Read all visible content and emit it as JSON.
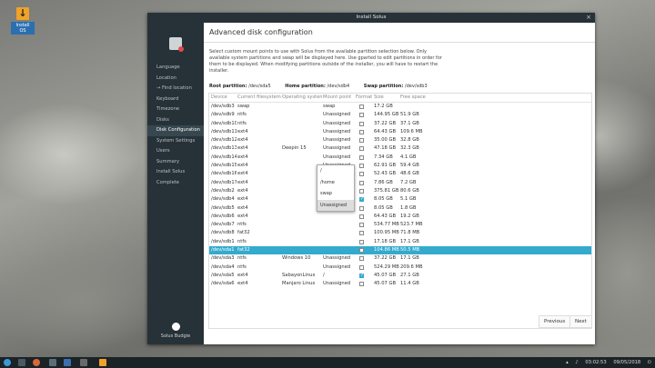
{
  "desktop": {
    "icon_label": "Install OS"
  },
  "window": {
    "title": "Install Solus",
    "close_glyph": "×"
  },
  "sidebar": {
    "items": [
      {
        "label": "Language"
      },
      {
        "label": "Location"
      },
      {
        "label": "→ Find location"
      },
      {
        "label": "Keyboard"
      },
      {
        "label": "Timezone"
      },
      {
        "label": "Disks"
      },
      {
        "label": "Disk Configuration"
      },
      {
        "label": "System Settings"
      },
      {
        "label": "Users"
      },
      {
        "label": "Summary"
      },
      {
        "label": "Install Solus"
      },
      {
        "label": "Complete"
      }
    ],
    "brand": "Solus Budgie"
  },
  "page": {
    "title": "Advanced disk configuration",
    "description": "Select custom mount points to use with Solus from the available partition selection below. Only available system partitions and swap will be displayed here. Use gparted to edit partitions in order for them to be displayed. When modifying partitions outside of the installer, you will have to restart the installer.",
    "root_label": "Root partition:",
    "root_value": "/dev/sda5",
    "home_label": "Home partition:",
    "home_value": "/dev/sdb4",
    "swap_label": "Swap partition:",
    "swap_value": "/dev/sdb3"
  },
  "table": {
    "headers": [
      "Device",
      "Current filesystem",
      "Operating system",
      "Mount point",
      "Format",
      "Size",
      "Free space"
    ],
    "rows": [
      {
        "device": "/dev/sdb3",
        "fs": "swap",
        "os": "",
        "mount": "swap",
        "format": false,
        "size": "17.2 GB",
        "free": ""
      },
      {
        "device": "/dev/sdb9",
        "fs": "ntfs",
        "os": "",
        "mount": "Unassigned",
        "format": false,
        "size": "144.95 GB",
        "free": "51.9 GB"
      },
      {
        "device": "/dev/sdb10",
        "fs": "ntfs",
        "os": "",
        "mount": "Unassigned",
        "format": false,
        "size": "37.22 GB",
        "free": "37.1 GB"
      },
      {
        "device": "/dev/sdb11",
        "fs": "ext4",
        "os": "",
        "mount": "Unassigned",
        "format": false,
        "size": "64.43 GB",
        "free": "109.6 MB"
      },
      {
        "device": "/dev/sdb12",
        "fs": "ext4",
        "os": "",
        "mount": "Unassigned",
        "format": false,
        "size": "35.00 GB",
        "free": "32.8 GB"
      },
      {
        "device": "/dev/sdb13",
        "fs": "ext4",
        "os": "Deepin 15",
        "mount": "Unassigned",
        "format": false,
        "size": "47.18 GB",
        "free": "32.3 GB"
      },
      {
        "device": "/dev/sdb14",
        "fs": "ext4",
        "os": "",
        "mount": "Unassigned",
        "format": false,
        "size": "7.34 GB",
        "free": "4.1 GB"
      },
      {
        "device": "/dev/sdb15",
        "fs": "ext4",
        "os": "",
        "mount": "Unassigned",
        "format": false,
        "size": "62.91 GB",
        "free": "59.4 GB"
      },
      {
        "device": "/dev/sdb16",
        "fs": "ext4",
        "os": "",
        "mount": "Unassigned",
        "format": false,
        "size": "52.43 GB",
        "free": "48.6 GB"
      },
      {
        "device": "/dev/sdb17",
        "fs": "ext4",
        "os": "",
        "mount": "Unassigned",
        "format": false,
        "size": "7.86 GB",
        "free": "7.2 GB"
      },
      {
        "device": "/dev/sdb2",
        "fs": "ext4",
        "os": "",
        "mount": "Unassigned",
        "format": false,
        "size": "375.81 GB",
        "free": "80.6 GB"
      },
      {
        "device": "/dev/sdb4",
        "fs": "ext4",
        "os": "",
        "mount": "/home",
        "format": true,
        "size": "8.05 GB",
        "free": "5.1 GB"
      },
      {
        "device": "/dev/sdb5",
        "fs": "ext4",
        "os": "",
        "mount": "Unassigned",
        "format": false,
        "size": "8.05 GB",
        "free": "1.8 GB"
      },
      {
        "device": "/dev/sdb6",
        "fs": "ext4",
        "os": "",
        "mount": "",
        "format": false,
        "size": "64.43 GB",
        "free": "19.2 GB"
      },
      {
        "device": "/dev/sdb7",
        "fs": "ntfs",
        "os": "",
        "mount": "",
        "format": false,
        "size": "534.77 MB",
        "free": "523.7 MB"
      },
      {
        "device": "/dev/sdb8",
        "fs": "fat32",
        "os": "",
        "mount": "",
        "format": false,
        "size": "100.95 MB",
        "free": "71.8 MB"
      },
      {
        "device": "/dev/sdb1",
        "fs": "ntfs",
        "os": "",
        "mount": "",
        "format": false,
        "size": "17.18 GB",
        "free": "17.1 GB"
      },
      {
        "device": "/dev/sda1",
        "fs": "fat32",
        "os": "",
        "mount": "",
        "format": false,
        "size": "104.86 MB",
        "free": "50.5 MB",
        "selected": true
      },
      {
        "device": "/dev/sda3",
        "fs": "ntfs",
        "os": "Windows 10",
        "mount": "Unassigned",
        "format": false,
        "size": "37.22 GB",
        "free": "17.1 GB"
      },
      {
        "device": "/dev/sda4",
        "fs": "ntfs",
        "os": "",
        "mount": "Unassigned",
        "format": false,
        "size": "524.29 MB",
        "free": "209.6 MB"
      },
      {
        "device": "/dev/sda5",
        "fs": "ext4",
        "os": "SabayonLinux",
        "mount": "/",
        "format": true,
        "size": "45.07 GB",
        "free": "27.1 GB"
      },
      {
        "device": "/dev/sda6",
        "fs": "ext4",
        "os": "Manjaro Linux",
        "mount": "Unassigned",
        "format": false,
        "size": "45.07 GB",
        "free": "11.4 GB"
      }
    ]
  },
  "dropdown": {
    "options": [
      "/",
      "/home",
      "swap",
      "Unassigned"
    ],
    "current": "Unassigned"
  },
  "buttons": {
    "previous": "Previous",
    "next": "Next"
  },
  "taskbar": {
    "time": "03:02:53",
    "date": "09/05/2018"
  },
  "colors": {
    "accent": "#34aacd",
    "sidebar": "#263238",
    "titlebar": "#263238"
  }
}
